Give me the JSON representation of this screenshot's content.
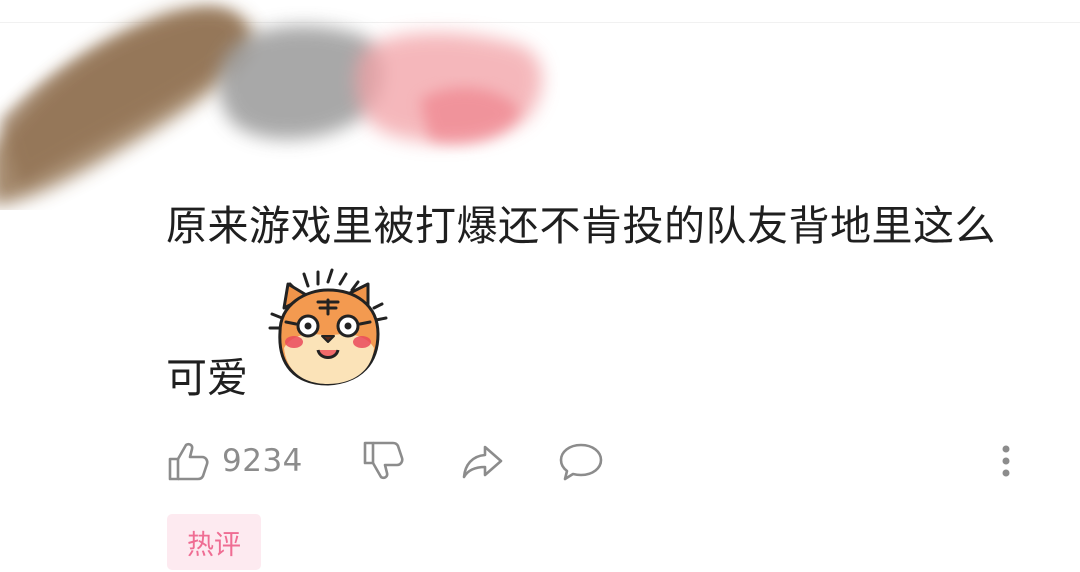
{
  "comment": {
    "text_line1": "原来游戏里被打爆还不肯投的队友背地里这么",
    "text_line2": "可爱",
    "sticker": "tiger-face-icon"
  },
  "actions": {
    "like_icon": "thumbs-up-icon",
    "like_count": "9234",
    "dislike_icon": "thumbs-down-icon",
    "share_icon": "share-arrow-icon",
    "reply_icon": "speech-bubble-icon",
    "more_icon": "vertical-ellipsis-icon"
  },
  "badge": {
    "label": "热评"
  },
  "colors": {
    "text": "#1f1f1f",
    "muted": "#8c8c8c",
    "badge_bg": "#fdeaf0",
    "badge_text": "#ef6d93"
  }
}
